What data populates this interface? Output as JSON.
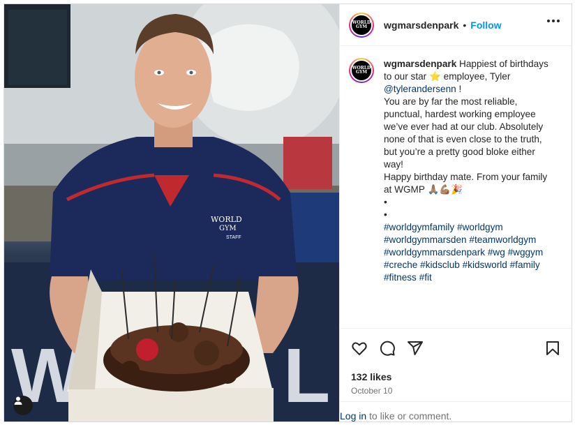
{
  "post": {
    "username": "wgmarsdenpark",
    "dot": "•",
    "follow_label": "Follow",
    "avatar_text_1": "WORLD",
    "avatar_text_2": "GYM"
  },
  "photo": {
    "shirt_logo_1": "WORLD",
    "shirt_logo_2": "GYM",
    "shirt_logo_3": "STAFF"
  },
  "caption": {
    "username": "wgmarsdenpark",
    "line1_pre": " Happiest of birthdays to our star ⭐ employee, Tyler ",
    "mention": "@tylerandersenn",
    "line1_post": " !",
    "para2": "You are by far the most reliable, punctual, hardest working employee we’ve ever had at our club. Absolutely none of that is even close to the truth, but you’re a pretty good bloke either way!",
    "para3": "Happy birthday mate. From your family at WGMP 🙏🏽💪🏽🎉",
    "bullet1": "•",
    "bullet2": "•",
    "hashtags": [
      "#worldgymfamily",
      "#worldgym",
      "#worldgymmarsden",
      "#teamworldgym",
      "#worldgymmarsdenpark",
      "#wg",
      "#wggym",
      "#creche",
      "#kidsclub",
      "#kidsworld",
      "#family",
      "#fitness",
      "#fit"
    ]
  },
  "engagement": {
    "likes": "132 likes",
    "date": "October 10",
    "login_link": "Log in",
    "login_rest": " to like or comment."
  },
  "icons": [
    "heart-icon",
    "comment-icon",
    "share-icon",
    "bookmark-icon",
    "more-icon",
    "user-tag-icon"
  ]
}
